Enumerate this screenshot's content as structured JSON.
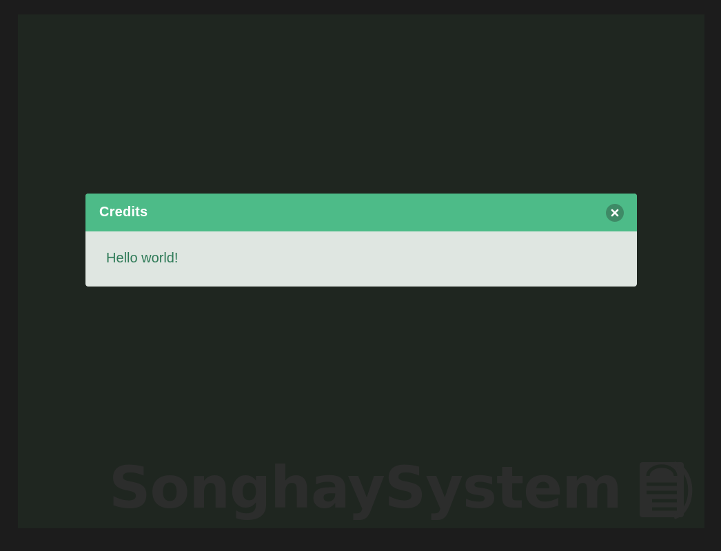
{
  "dialog": {
    "title": "Credits",
    "message": "Hello world!",
    "close_icon": "close-icon"
  },
  "watermark": {
    "text": "SonghaySystem",
    "logo_icon": "songhay-logo-icon"
  },
  "colors": {
    "page_background": "#1c1c1c",
    "stage_background": "#1f2620",
    "header_accent": "#4dbb88",
    "close_button": "#3e8a66",
    "dialog_body": "#dfe6e1",
    "message_text": "#2e7a57"
  }
}
